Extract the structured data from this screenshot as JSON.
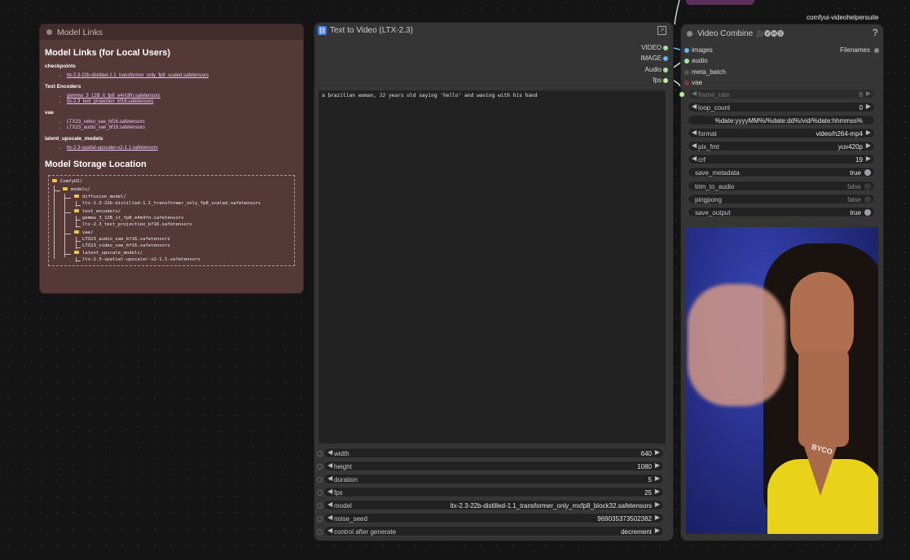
{
  "note": {
    "title": "Model Links",
    "heading": "Model Links (for Local Users)",
    "sections": [
      {
        "label": "checkpoints",
        "links": [
          "ltx-2.3-22b-distilled-1.1_transformer_only_fp8_scaled.safetensors"
        ]
      },
      {
        "label": "Text Encoders",
        "links": [
          "gemma_3_12B_it_fp8_e4m3fn.safetensors",
          "ltx-2.3_text_projection_bf16.safetensors"
        ]
      },
      {
        "label": "vae",
        "links": [
          "LTX23_video_vae_bf16.safetensors",
          "LTX23_audio_vae_bf16.safetensors"
        ]
      },
      {
        "label": "latent_upscale_models",
        "links": [
          "ltx-2.3-spatial-upscaler-x2-1.1.safetensors"
        ]
      }
    ],
    "storage_heading": "Model Storage Location",
    "tree": [
      "ComfyUI/",
      "models/",
      "diffusion_model/",
      "ltx-2.3-22b-distilled-1.1_transformer_only_fp8_scaled.safetensors",
      "text_encoders/",
      "gemma_3_12B_it_fp8_e4m3fn.safetensors",
      "ltx-2.3_text_projection_bf16.safetensors",
      "vae/",
      "LTX23_audio_vae_bf16.safetensors",
      "LTX23_video_vae_bf16.safetensors",
      "latent_upscale_models/",
      "ltx-2.3-spatial-upscaler-x2-1.1.safetensors"
    ]
  },
  "t2v": {
    "title": "Text to Video (LTX-2.3)",
    "outputs": [
      "VIDEO",
      "IMAGE",
      "Audio",
      "fps"
    ],
    "prompt": "a brazilian woman, 22 years old saying 'hello' and waving with his hand",
    "widgets": [
      {
        "label": "width",
        "value": "640"
      },
      {
        "label": "height",
        "value": "1080"
      },
      {
        "label": "duration",
        "value": "5"
      },
      {
        "label": "fps",
        "value": "25"
      },
      {
        "label": "model",
        "value": "ltx-2.3-22b-distilled-1.1_transformer_only_mxfp8_block32.safetensors"
      },
      {
        "label": "noise_seed",
        "value": "969035373502382"
      },
      {
        "label": "control after generate",
        "value": "decrement"
      }
    ]
  },
  "vc": {
    "title": "Video Combine",
    "badge": "comfyui-videohelpersuite",
    "title_emoji": "🎥🅥🅗🅢",
    "help": "?",
    "inputs": [
      "images",
      "audio",
      "meta_batch",
      "vae"
    ],
    "output": "Filenames",
    "widgets": [
      {
        "label": "frame_rate",
        "value": "8"
      },
      {
        "label": "loop_count",
        "value": "0"
      },
      {
        "label": "",
        "value": "%date:yyyyMM%/%date:dd%/vid/%date:hhmmss%"
      },
      {
        "label": "format",
        "value": "video/h264-mp4"
      },
      {
        "label": "pix_fmt",
        "value": "yuv420p"
      },
      {
        "label": "crf",
        "value": "19"
      },
      {
        "label": "save_metadata",
        "value": "true"
      },
      {
        "label": "trim_to_audio",
        "value": "false"
      },
      {
        "label": "pingpong",
        "value": "false"
      },
      {
        "label": "save_output",
        "value": "true"
      }
    ],
    "preview_necklace": "BYCO"
  },
  "colors": {
    "note_bg": "#553838",
    "link": "#f2c8ff",
    "image_socket": "#64b5f6",
    "audio_socket": "#a6e3a1",
    "vae_socket": "#ff6e6e",
    "int_socket": "#b6f0a0",
    "preview_bg": "#2b3a9a",
    "top_node": "#5b2e5b"
  }
}
